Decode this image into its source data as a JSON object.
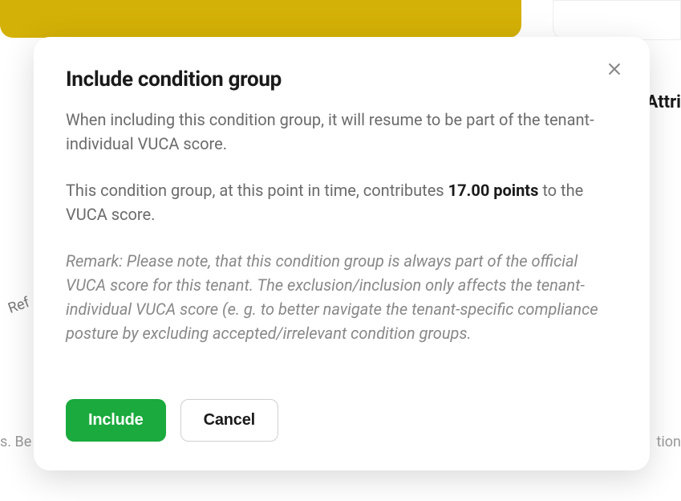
{
  "modal": {
    "title": "Include condition group",
    "body_para1": "When including this condition group, it will resume to be part of the tenant-individual VUCA score.",
    "body_para2_prefix": "This condition group, at this point in time, contributes ",
    "points": "17.00 points",
    "body_para2_suffix": " to the VUCA score.",
    "remark": "Remark: Please note, that this condition group is always part of the official VUCA score for this tenant. The exclusion/inclusion only affects the tenant-individual VUCA score (e. g. to better navigate the tenant-specific compliance posture by excluding accepted/irrelevant condition groups.",
    "include_label": "Include",
    "cancel_label": "Cancel"
  },
  "background": {
    "left_text": "s. Be",
    "right_text_1": "Attri",
    "right_text_2": "tion",
    "ref_text": "Ref"
  }
}
